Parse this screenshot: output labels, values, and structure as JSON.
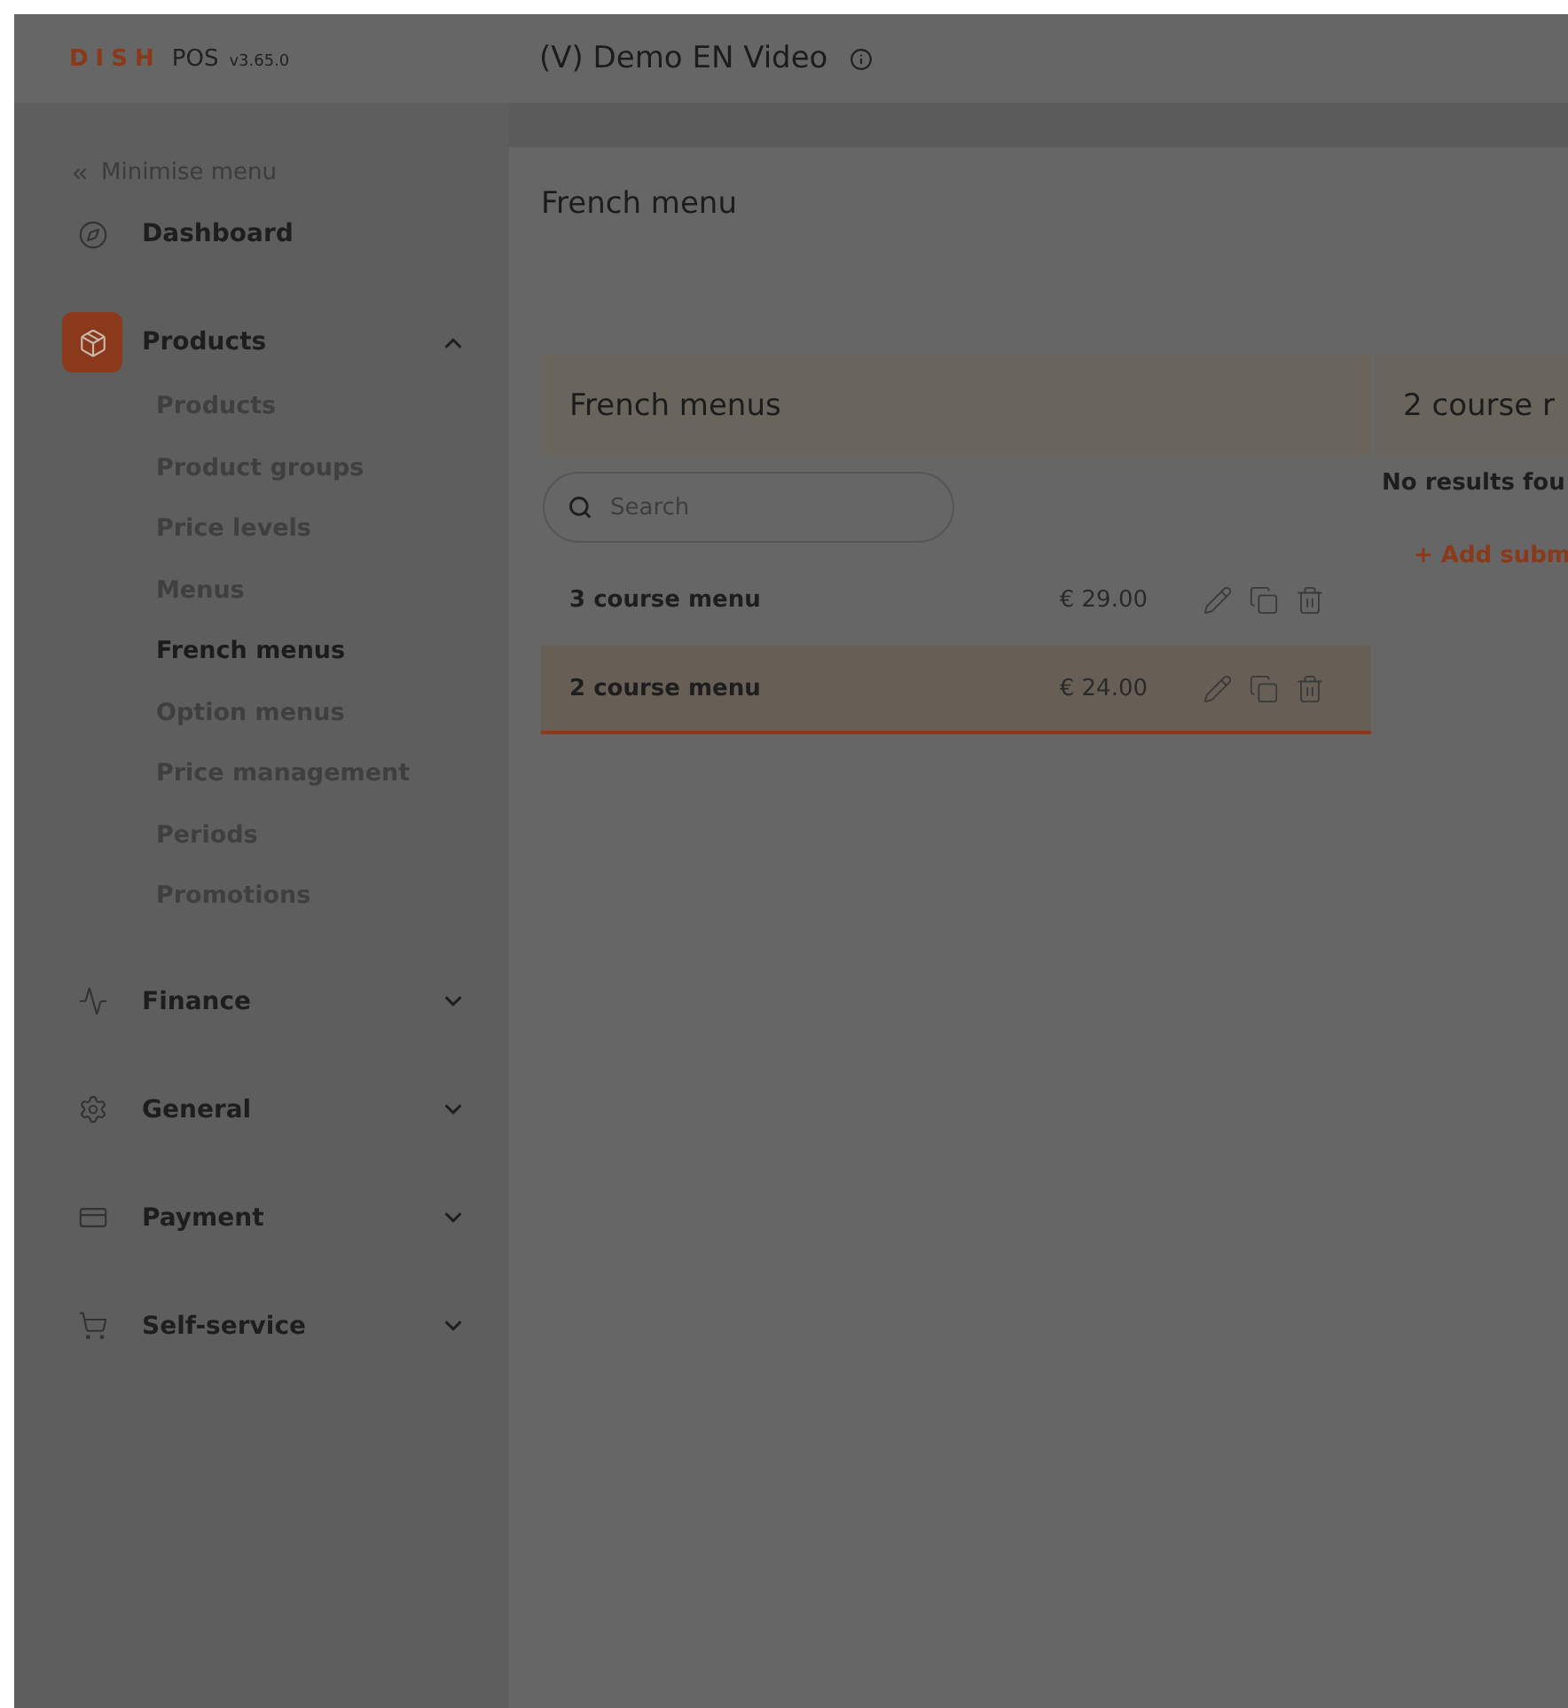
{
  "header": {
    "logo": {
      "brand": "DISH",
      "product": "POS",
      "version": "v3.65.0"
    },
    "title": "(V) Demo EN Video"
  },
  "sidebar": {
    "minimise": "Minimise menu",
    "items": [
      {
        "label": "Dashboard",
        "selected": false
      },
      {
        "label": "Products",
        "selected": true,
        "expanded": true,
        "children": [
          {
            "label": "Products",
            "selected": false
          },
          {
            "label": "Product groups",
            "selected": false
          },
          {
            "label": "Price levels",
            "selected": false
          },
          {
            "label": "Menus",
            "selected": false
          },
          {
            "label": "French menus",
            "selected": true
          },
          {
            "label": "Option menus",
            "selected": false
          },
          {
            "label": "Price management",
            "selected": false
          },
          {
            "label": "Periods",
            "selected": false
          },
          {
            "label": "Promotions",
            "selected": false
          }
        ]
      },
      {
        "label": "Finance",
        "selected": false,
        "expanded": false
      },
      {
        "label": "General",
        "selected": false,
        "expanded": false
      },
      {
        "label": "Payment",
        "selected": false,
        "expanded": false
      },
      {
        "label": "Self-service",
        "selected": false,
        "expanded": false
      }
    ]
  },
  "page_title": "French menu",
  "list_panel": {
    "title": "French menus",
    "search": {
      "placeholder": "Search"
    },
    "rows": [
      {
        "name": "3 course menu",
        "price": "€ 29.00",
        "selected": false
      },
      {
        "name": "2 course menu",
        "price": "€ 24.00",
        "selected": true
      }
    ]
  },
  "detail_panel": {
    "title": "2 course r",
    "empty": "No results fou",
    "add": "+ Add subm"
  }
}
